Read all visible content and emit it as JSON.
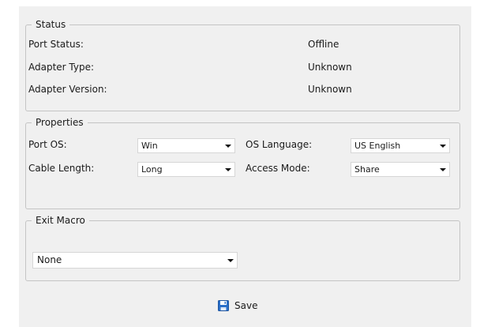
{
  "status": {
    "legend": "Status",
    "rows": [
      {
        "label": "Port Status:",
        "value": "Offline"
      },
      {
        "label": "Adapter Type:",
        "value": "Unknown"
      },
      {
        "label": "Adapter Version:",
        "value": "Unknown"
      }
    ]
  },
  "properties": {
    "legend": "Properties",
    "port_os": {
      "label": "Port OS:",
      "value": "Win"
    },
    "os_language": {
      "label": "OS Language:",
      "value": "US English"
    },
    "cable_length": {
      "label": "Cable Length:",
      "value": "Long"
    },
    "access_mode": {
      "label": "Access Mode:",
      "value": "Share"
    }
  },
  "exit_macro": {
    "legend": "Exit Macro",
    "value": "None"
  },
  "save": {
    "label": "Save",
    "icon": "floppy-disk-icon",
    "icon_color": "#2a6fc9"
  }
}
